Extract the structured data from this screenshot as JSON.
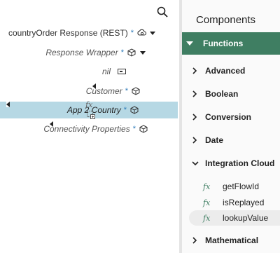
{
  "tree": {
    "search_icon": "search-icon",
    "rows": [
      {
        "label": "countryOrder Response (REST)",
        "star": "*",
        "icon": "rest-icon"
      },
      {
        "label": "Response Wrapper",
        "star": "*",
        "icon": "object-icon"
      },
      {
        "label": "nil",
        "icon": "attribute-icon"
      },
      {
        "label": "Customer",
        "star": "*",
        "icon": "object-icon"
      },
      {
        "label": "App 2 Country",
        "star": "*",
        "icon": "object-icon"
      },
      {
        "label": "Connectivity Properties",
        "star": "*",
        "icon": "object-icon"
      }
    ],
    "drag_label": "fx"
  },
  "components": {
    "title": "Components",
    "functions_label": "Functions",
    "categories": [
      "Advanced",
      "Boolean",
      "Conversion",
      "Date",
      "Integration Cloud",
      "Mathematical"
    ],
    "functions": [
      {
        "fx": "fx",
        "name": "getFlowId"
      },
      {
        "fx": "fx",
        "name": "isReplayed"
      },
      {
        "fx": "fx",
        "name": "lookupValue"
      }
    ]
  },
  "colors": {
    "functions_header": "#3f7e62",
    "selected_row": "#b6d8e4",
    "required_star": "#2a79b8"
  }
}
